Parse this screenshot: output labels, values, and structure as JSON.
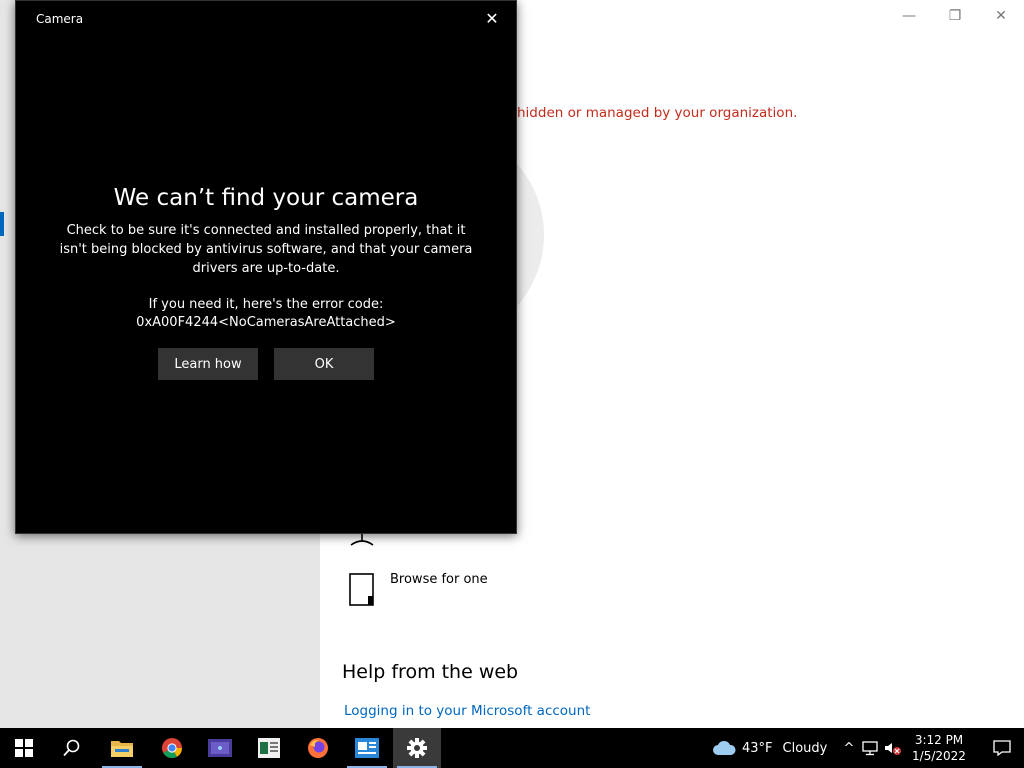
{
  "settings": {
    "window_controls": {
      "minimize": "—",
      "restore": "❐",
      "close": "✕"
    },
    "org_message": "hidden or managed by your organization.",
    "browse_label": "Browse for one",
    "help_heading": "Help from the web",
    "help_link": "Logging in to your Microsoft account"
  },
  "camera_dialog": {
    "title": "Camera",
    "close_glyph": "✕",
    "heading": "We can’t find your camera",
    "body": "Check to be sure it's connected and installed properly, that it isn't being blocked by antivirus software, and that your camera drivers are up-to-date.",
    "error_intro": "If you need it, here's the error code:",
    "error_code": "0xA00F4244<NoCamerasAreAttached>",
    "learn_button": "Learn how",
    "ok_button": "OK"
  },
  "taskbar": {
    "weather_temp": "43°F",
    "weather_condition": "Cloudy",
    "tray_chevron": "^",
    "time": "3:12 PM",
    "date": "1/5/2022",
    "icons": [
      "windows-start-icon",
      "search-icon",
      "file-explorer-icon",
      "chrome-icon",
      "app-icon",
      "app-icon",
      "firefox-icon",
      "app-icon",
      "settings-gear-icon"
    ]
  },
  "colors": {
    "accent": "#0067c0",
    "org_warning": "#c42b1c",
    "dialog_bg": "#000000",
    "button_bg": "#333333"
  }
}
